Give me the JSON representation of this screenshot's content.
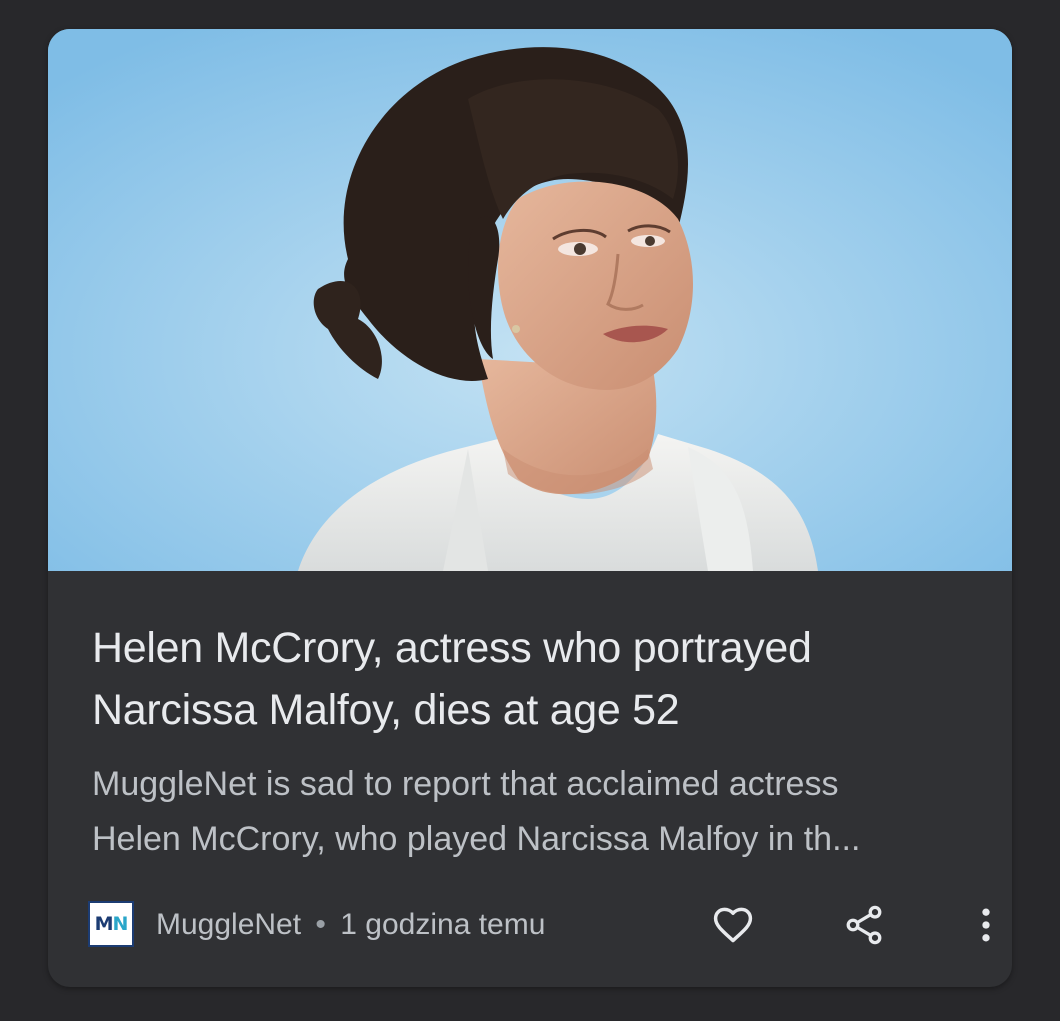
{
  "article": {
    "title_line1": "Helen McCrory, actress who portrayed",
    "title_line2": "Narcissa Malfoy, dies at age 52",
    "snippet_line1": "MuggleNet is sad to report that acclaimed actress",
    "snippet_line2": "Helen McCrory, who played Narcissa Malfoy in th...",
    "image_description": "portrait-photo"
  },
  "source": {
    "logo_m": "M",
    "logo_n": "N",
    "name": "MuggleNet",
    "separator": "•",
    "time": "1 godzina temu"
  },
  "actions": {
    "like_icon": "heart-outline-icon",
    "share_icon": "share-icon",
    "more_icon": "more-vert-icon"
  },
  "colors": {
    "background": "#28282b",
    "card": "#303134",
    "title": "#e8eaed",
    "snippet": "#bdc1c6",
    "logo_border": "#1c3c73",
    "logo_accent": "#2aa6c9"
  }
}
